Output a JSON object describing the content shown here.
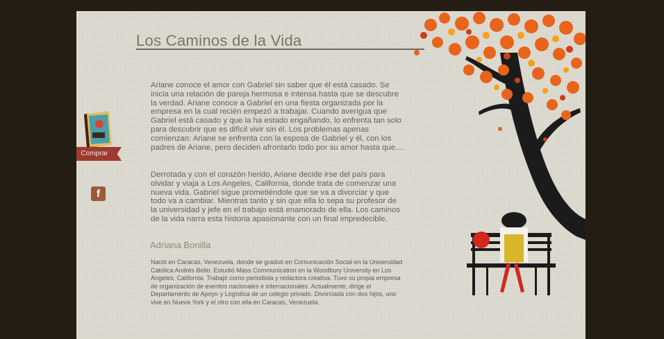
{
  "page": {
    "title": "Los Caminos de la Vida"
  },
  "synopsis": {
    "paragraph1": "Ariane conoce el amor con Gabriel sin saber que él está casado. Se inicia una relación de pareja hermosa e intensa hasta que se descubre la verdad. Ariane conoce a Gabriel en una fiesta organizada por la empresa en la cual recién empezó a trabajar. Cuando averigua que Gabriel está casado y que la ha estado engañando, lo enfrenta tan solo para descubrir que es difícil vivir sin él. Los problemas apenas comienzan: Ariane se enfrenta con la esposa de Gabriel y él, con los padres de Ariane, pero deciden afrontarlo todo por su amor hasta que....",
    "paragraph2": "Derrotada y con el corazón herido, Ariane decide irse del país para olvidar y viaja a Los Angeles, California, donde trata de comenzar una nueva vida. Gabriel sigue prometiéndole que se va a divorciar y que todo va a cambiar. Mientras tanto y sin que ella lo sepa su profesor de la universidad y jefe en el trabajo está enamorado de ella. Los caminos de la vida narra esta historia apasionante con un final impredecible."
  },
  "author": {
    "name": "Adriana Bonilla",
    "bio": "Nació en Caracas, Venezuela, donde se graduó en Comunicación Social en la Universidad Católica Andrés Bello. Estudió Mass Communication en la Woodbury University en Los Angeles, California. Trabajó como periodista y redactora creativa. Tuvo su propia empresa de organización de eventos nacionales e internacionales. Actualmente, dirige el Departamento de Apoyo y Logística de un colegio privado. Divorciada con dos hijos, uno vive en Nueva York y el otro con ella en Caracas, Venezuela."
  },
  "sidebar": {
    "buy_label": "Comprar",
    "facebook_icon": "facebook-icon",
    "facebook_glyph": "f"
  },
  "colors": {
    "background": "#231d14",
    "paper": "#d9d6cc",
    "ribbon": "#9e3a30",
    "leaves": "#e8641c"
  }
}
